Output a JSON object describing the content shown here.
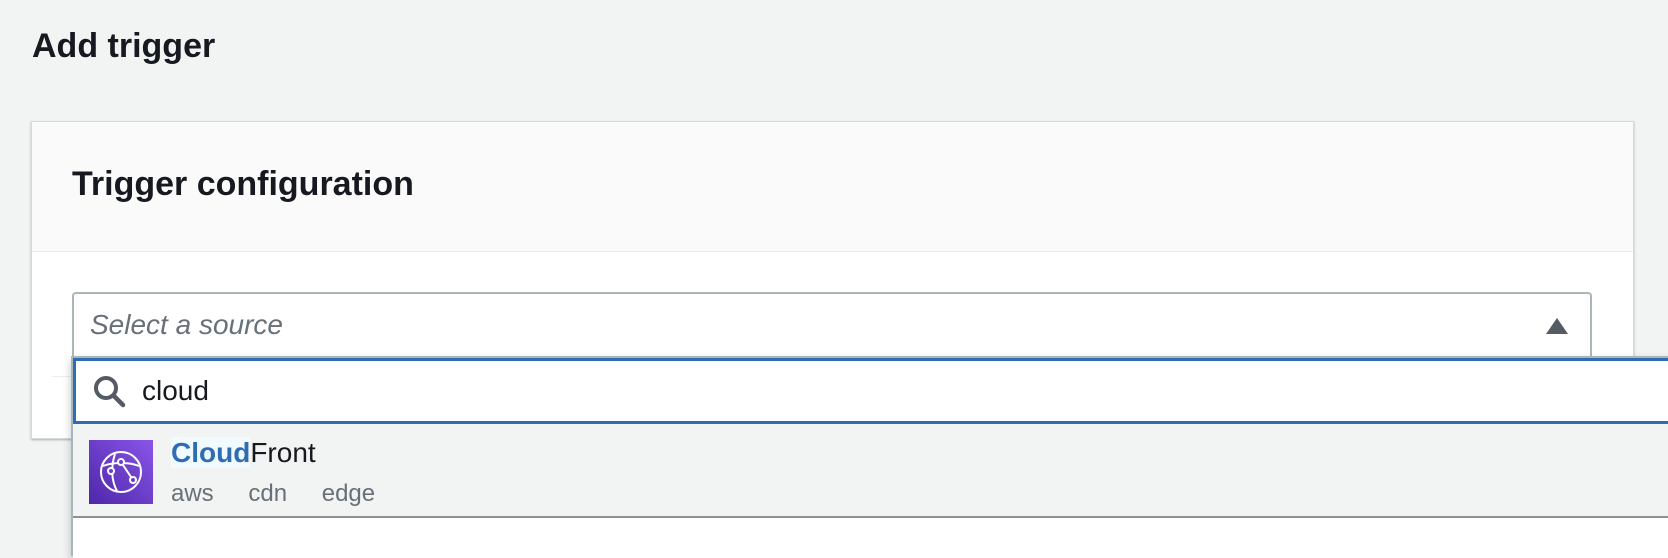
{
  "page": {
    "title": "Add trigger"
  },
  "panel": {
    "title": "Trigger configuration"
  },
  "source_select": {
    "placeholder": "Select a source",
    "expanded": true
  },
  "filter": {
    "value": "cloud",
    "icon": "search-icon"
  },
  "options": [
    {
      "label_match": "Cloud",
      "label_rest": "Front",
      "icon": "cloudfront-icon",
      "tags": [
        "aws",
        "cdn",
        "edge"
      ]
    }
  ],
  "colors": {
    "accent": "#2e6db4",
    "background": "#f2f3f3",
    "icon_gradient_start": "#4d27aa",
    "icon_gradient_end": "#8a55e8"
  }
}
